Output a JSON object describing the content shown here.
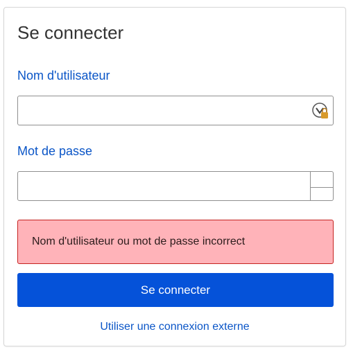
{
  "page": {
    "title": "Se connecter"
  },
  "username": {
    "label": "Nom d'utilisateur",
    "value": "",
    "placeholder": ""
  },
  "password": {
    "label": "Mot de passe",
    "value": "",
    "placeholder": ""
  },
  "alert": {
    "message": "Nom d'utilisateur ou mot de passe incorrect",
    "background": "#ffb3b9",
    "border": "#c5221f"
  },
  "actions": {
    "submit_label": "Se connecter",
    "submit_color": "#0552d9",
    "external_link": "Utiliser une connexion externe"
  },
  "icons": {
    "username_field_icon": "password-manager-lock-icon",
    "password_toggle": "reveal-password-icon"
  }
}
